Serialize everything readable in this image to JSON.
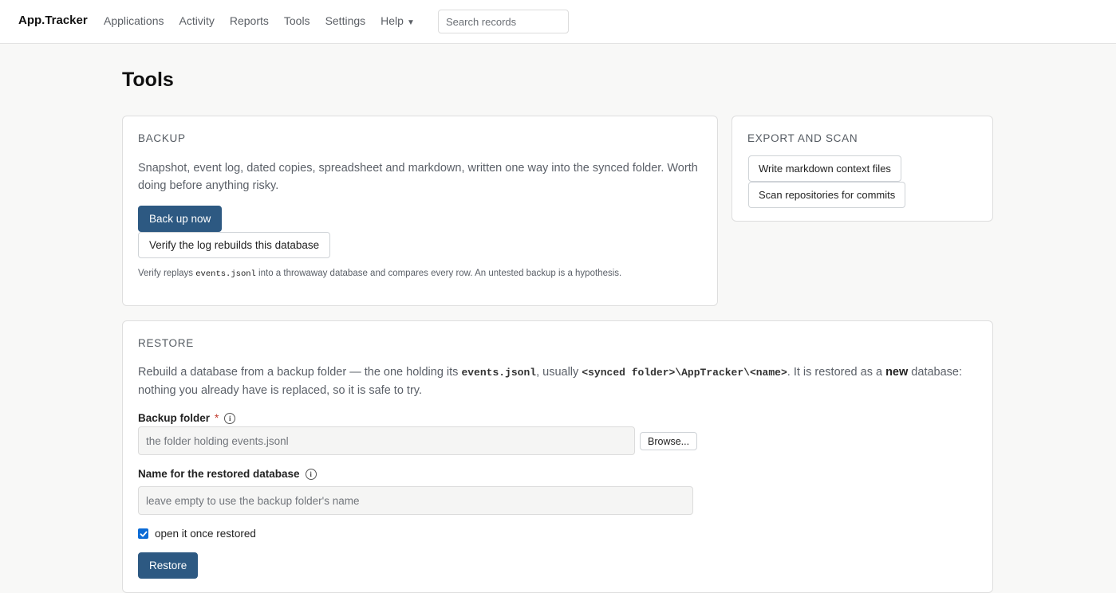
{
  "app": {
    "brand": "App.Tracker"
  },
  "nav": {
    "items": [
      {
        "label": "Applications"
      },
      {
        "label": "Activity"
      },
      {
        "label": "Reports"
      },
      {
        "label": "Tools"
      },
      {
        "label": "Settings"
      }
    ],
    "help_label": "Help",
    "search_placeholder": "Search records"
  },
  "page": {
    "title": "Tools"
  },
  "backup": {
    "heading": "BACKUP",
    "description": "Snapshot, event log, dated copies, spreadsheet and markdown, written one way into the synced folder. Worth doing before anything risky.",
    "primary_button": "Back up now",
    "secondary_button": "Verify the log rebuilds this database",
    "note_prefix": "Verify replays ",
    "note_code": "events.jsonl",
    "note_suffix": " into a throwaway database and compares every row. An untested backup is a hypothesis."
  },
  "export": {
    "heading": "EXPORT AND SCAN",
    "button_markdown": "Write markdown context files",
    "button_scan": "Scan repositories for commits"
  },
  "restore": {
    "heading": "RESTORE",
    "desc_part1": "Rebuild a database from a backup folder — the one holding its ",
    "desc_code1": "events.jsonl",
    "desc_part2": ", usually ",
    "desc_code2": "<synced folder>\\AppTracker\\<name>",
    "desc_part3": ". It is restored as a ",
    "desc_strong": "new",
    "desc_part4": " database: nothing you already have is replaced, so it is safe to try.",
    "folder_label": "Backup folder",
    "folder_required": "*",
    "folder_placeholder": "the folder holding events.jsonl",
    "browse_button": "Browse...",
    "name_label": "Name for the restored database",
    "name_placeholder": "leave empty to use the backup folder's name",
    "open_checkbox_label": "open it once restored",
    "open_checked": true,
    "restore_button": "Restore"
  },
  "colors": {
    "primary_button": "#2d5982",
    "checkbox": "#0b6bd6",
    "page_background": "#f8f8f7"
  }
}
